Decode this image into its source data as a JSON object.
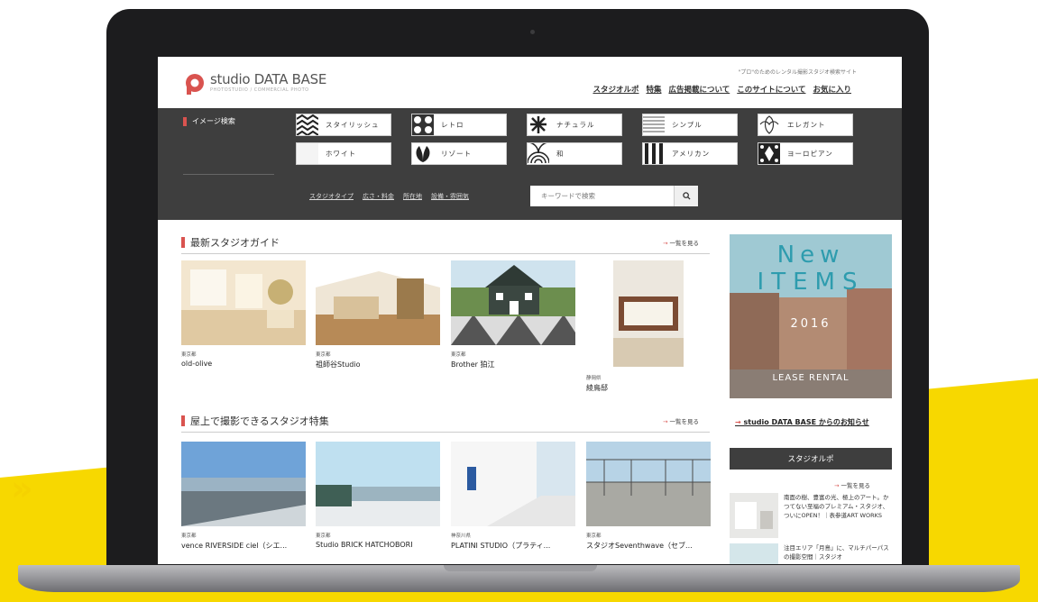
{
  "colors": {
    "accent": "#d9534f",
    "dark_band": "#3e3e3e",
    "yellow": "#f5d200"
  },
  "decor": {
    "chevrons": "»"
  },
  "header": {
    "logo_text": "studio DATA BASE",
    "logo_sub": "PHOTOSTUDIO / COMMERCIAL PHOTO",
    "tagline": "\"プロ\"のためのレンタル撮影スタジオ検索サイト",
    "nav": [
      "スタジオルポ",
      "特集",
      "広告掲載について",
      "このサイトについて",
      "お気に入り"
    ]
  },
  "image_search": {
    "title": "イメージ検索",
    "tags": [
      {
        "label": "スタイリッシュ",
        "icon": "zigzag-icon"
      },
      {
        "label": "レトロ",
        "icon": "retro-pattern-icon"
      },
      {
        "label": "ナチュラル",
        "icon": "leaf-icon"
      },
      {
        "label": "シンプル",
        "icon": "lines-icon"
      },
      {
        "label": "エレガント",
        "icon": "ornament-icon"
      },
      {
        "label": "ホワイト",
        "icon": "white-swatch-icon"
      },
      {
        "label": "リゾート",
        "icon": "palm-leaf-icon"
      },
      {
        "label": "和",
        "icon": "wave-pattern-icon"
      },
      {
        "label": "アメリカン",
        "icon": "stripes-icon"
      },
      {
        "label": "ヨーロピアン",
        "icon": "damask-icon"
      }
    ],
    "filters": [
      "スタジオタイプ",
      "広さ・料金",
      "所在地",
      "設備・雰囲気"
    ],
    "keyword_placeholder": "キーワードで検索"
  },
  "latest": {
    "title": "最新スタジオガイド",
    "more": "一覧を見る",
    "cards": [
      {
        "pref": "東京都",
        "name": "old-olive"
      },
      {
        "pref": "東京都",
        "name": "祖師谷Studio"
      },
      {
        "pref": "東京都",
        "name": "Brother 狛江"
      },
      {
        "pref": "静岡県",
        "name": "綾鳥邸"
      }
    ]
  },
  "rooftop": {
    "title": "屋上で撮影できるスタジオ特集",
    "more": "一覧を見る",
    "cards": [
      {
        "pref": "東京都",
        "name": "vence RIVERSIDE ciel（シエ..."
      },
      {
        "pref": "東京都",
        "name": "Studio BRICK HATCHOBORI"
      },
      {
        "pref": "神奈川県",
        "name": "PLATINI STUDIO（プラティ..."
      },
      {
        "pref": "東京都",
        "name": "スタジオSeventhwave（セブ..."
      }
    ]
  },
  "sidebar": {
    "banner_line1": "New",
    "banner_line2": "ITEMS",
    "banner_year": "2016",
    "banner_sub": "LEASE RENTAL",
    "notice_link": "studio DATA BASE からのお知らせ",
    "repo_title": "スタジオルポ",
    "repo_more": "一覧を見る",
    "repo_items": [
      "南面の樹、豊富の光、極上のアート。かつてない至福のプレミアム・スタジオ、ついにOPEN！｜表参道ART WORKS",
      "注目エリア「月島」に、マルチパーパスの撮影空間｜スタジオ"
    ]
  }
}
